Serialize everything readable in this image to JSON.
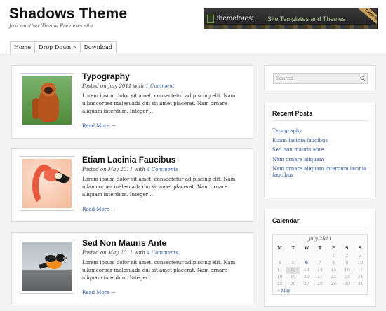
{
  "header": {
    "site_title": "Shadows Theme",
    "tagline": "Just another Theme Previews site",
    "banner": {
      "brand": "themeforest",
      "tagline": "Site Templates and Themes",
      "ribbon": "Theme $9"
    }
  },
  "nav": {
    "items": [
      {
        "label": "Home"
      },
      {
        "label": "Drop Down »"
      },
      {
        "label": "Download"
      }
    ]
  },
  "posts": [
    {
      "title": "Typography",
      "meta_prefix": "Posted on July 2011 with ",
      "comments": "1 Comment",
      "excerpt": "Lorem ipsum dolor sit amet, consectetur adipiscing elit. Nam ullamcorper malesuada dui sit amet placerat. Nam ornare aliquam interdum. Integer…",
      "read_more": "Read More →",
      "thumb_icon": "orangutan-photo"
    },
    {
      "title": "Etiam Lacinia Faucibus",
      "meta_prefix": "Posted on May 2011 with ",
      "comments": "4 Comments",
      "excerpt": "Lorem ipsum dolor sit amet, consectetur adipiscing elit. Nam ullamcorper malesuada dui sit amet placerat. Nam ornare aliquam interdum. Integer…",
      "read_more": "Read More →",
      "thumb_icon": "flamingo-photo"
    },
    {
      "title": "Sed Non Mauris Ante",
      "meta_prefix": "Posted on May 2011 with ",
      "comments": "4 Comments",
      "excerpt": "Lorem ipsum dolor sit amet, consectetur adipiscing elit. Nam ullamcorper malesuada dui sit amet placerat. Nam ornare aliquam interdum. Integer…",
      "read_more": "Read More →",
      "thumb_icon": "oriole-photo"
    }
  ],
  "sidebar": {
    "search": {
      "placeholder": "Search"
    },
    "recent_posts": {
      "title": "Recent Posts",
      "items": [
        "Typography",
        "Etiam lacinia faucibus",
        "Sed non mauris ante",
        "Nam ornare aliquam",
        "Nam ornare aliquam interdum lacinia faucibus"
      ]
    },
    "calendar": {
      "title": "Calendar",
      "caption": "July 2011",
      "weekdays": [
        "M",
        "T",
        "W",
        "T",
        "F",
        "S",
        "S"
      ],
      "weeks": [
        [
          "",
          "",
          "",
          "",
          "1",
          "2",
          "3"
        ],
        [
          "4",
          "5",
          "6",
          "7",
          "8",
          "9",
          "10"
        ],
        [
          "11",
          "12",
          "13",
          "14",
          "15",
          "16",
          "17"
        ],
        [
          "18",
          "19",
          "20",
          "21",
          "22",
          "23",
          "24"
        ],
        [
          "25",
          "26",
          "27",
          "28",
          "29",
          "30",
          "31"
        ]
      ],
      "linked_day": "6",
      "today": "12",
      "prev_label": "« May"
    }
  },
  "colors": {
    "link": "#2a52a0",
    "background": "#f3f3f3",
    "card": "#ffffff"
  }
}
